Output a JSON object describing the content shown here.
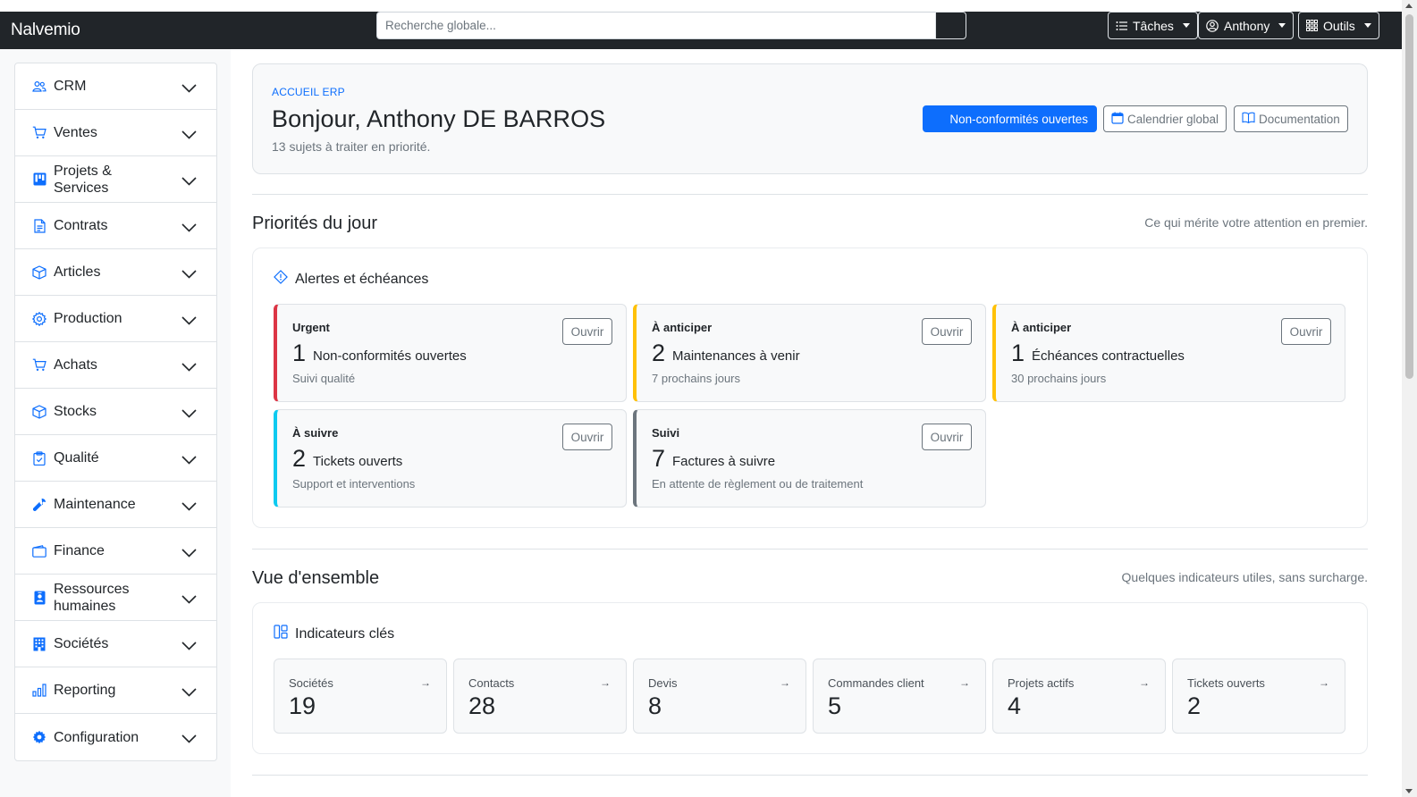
{
  "app": {
    "brand": "Nalvemio"
  },
  "search": {
    "placeholder": "Recherche globale..."
  },
  "nav": {
    "tasks_label": "Tâches",
    "user_label": "Anthony",
    "tools_label": "Outils"
  },
  "sidebar": {
    "items": [
      {
        "label": "CRM",
        "icon": "users-icon"
      },
      {
        "label": "Ventes",
        "icon": "cart-icon"
      },
      {
        "label": "Projets & Services",
        "icon": "kanban-icon"
      },
      {
        "label": "Contrats",
        "icon": "document-icon"
      },
      {
        "label": "Articles",
        "icon": "box-icon"
      },
      {
        "label": "Production",
        "icon": "gear-icon"
      },
      {
        "label": "Achats",
        "icon": "cart-icon"
      },
      {
        "label": "Stocks",
        "icon": "box-icon"
      },
      {
        "label": "Qualité",
        "icon": "clipboard-check-icon"
      },
      {
        "label": "Maintenance",
        "icon": "wrench-icon"
      },
      {
        "label": "Finance",
        "icon": "wallet-icon"
      },
      {
        "label": "Ressources humaines",
        "icon": "person-badge-icon"
      },
      {
        "label": "Sociétés",
        "icon": "building-icon"
      },
      {
        "label": "Reporting",
        "icon": "bar-chart-icon"
      },
      {
        "label": "Configuration",
        "icon": "gear-fill-icon"
      }
    ]
  },
  "hero": {
    "eyebrow": "ACCUEIL ERP",
    "title": "Bonjour, Anthony DE BARROS",
    "subtitle": "13 sujets à traiter en priorité.",
    "primary_button": "Non-conformités ouvertes",
    "calendar_button": "Calendrier global",
    "docs_button": "Documentation"
  },
  "priorities": {
    "title": "Priorités du jour",
    "note": "Ce qui mérite votre attention en premier.",
    "panel_title": "Alertes et échéances",
    "open_label": "Ouvrir",
    "alerts": [
      {
        "kind": "Urgent",
        "count": "1",
        "title": "Non-conformités ouvertes",
        "sub": "Suivi qualité",
        "color": "#dc3545"
      },
      {
        "kind": "À anticiper",
        "count": "2",
        "title": "Maintenances à venir",
        "sub": "7 prochains jours",
        "color": "#ffc107"
      },
      {
        "kind": "À anticiper",
        "count": "1",
        "title": "Échéances contractuelles",
        "sub": "30 prochains jours",
        "color": "#ffc107"
      },
      {
        "kind": "À suivre",
        "count": "2",
        "title": "Tickets ouverts",
        "sub": "Support et interventions",
        "color": "#0dcaf0"
      },
      {
        "kind": "Suivi",
        "count": "7",
        "title": "Factures à suivre",
        "sub": "En attente de règlement ou de traitement",
        "color": "#6c757d"
      }
    ]
  },
  "overview": {
    "title": "Vue d'ensemble",
    "note": "Quelques indicateurs utiles, sans surcharge.",
    "panel_title": "Indicateurs clés",
    "kpis": [
      {
        "label": "Sociétés",
        "value": "19"
      },
      {
        "label": "Contacts",
        "value": "28"
      },
      {
        "label": "Devis",
        "value": "8"
      },
      {
        "label": "Commandes client",
        "value": "5"
      },
      {
        "label": "Projets actifs",
        "value": "4"
      },
      {
        "label": "Tickets ouverts",
        "value": "2"
      }
    ]
  },
  "colors": {
    "accent": "#0d6efd",
    "navbar": "#212529"
  }
}
